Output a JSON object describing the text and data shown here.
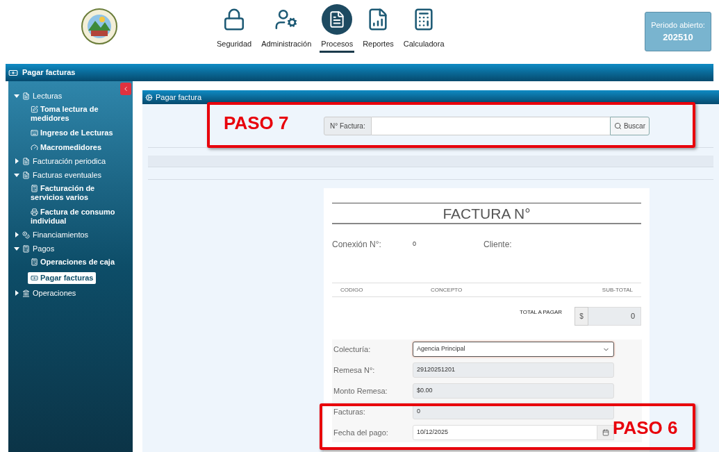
{
  "header": {
    "nav": [
      {
        "label": "Seguridad",
        "kind": "security",
        "selected": false
      },
      {
        "label": "Administración",
        "kind": "admin",
        "selected": false
      },
      {
        "label": "Procesos",
        "kind": "process",
        "selected": true
      },
      {
        "label": "Reportes",
        "kind": "report",
        "selected": false
      },
      {
        "label": "Calculadora",
        "kind": "calc",
        "selected": false
      }
    ],
    "period": {
      "label": "Periodo abierto:",
      "value": "202510"
    }
  },
  "window": {
    "title": "Pagar facturas"
  },
  "sidebar": {
    "items": [
      {
        "label": "Lecturas",
        "kind": "file",
        "expanded": true,
        "children": [
          {
            "label": "Toma lectura de medidores",
            "kind": "edit",
            "selected": false
          },
          {
            "label": "Ingreso de Lecturas",
            "kind": "keyboard",
            "selected": false
          },
          {
            "label": "Macromedidores",
            "kind": "gauge",
            "selected": false
          }
        ]
      },
      {
        "label": "Facturación periodica",
        "kind": "file",
        "expanded": false
      },
      {
        "label": "Facturas eventuales",
        "kind": "file",
        "expanded": true,
        "children": [
          {
            "label": "Facturación de servicios varios",
            "kind": "register",
            "selected": false
          },
          {
            "label": "Factura de consumo individual",
            "kind": "print",
            "selected": false
          }
        ]
      },
      {
        "label": "Financiamientos",
        "kind": "coins",
        "expanded": false
      },
      {
        "label": "Pagos",
        "kind": "register",
        "expanded": true,
        "children": [
          {
            "label": "Operaciones de caja",
            "kind": "register",
            "selected": false
          },
          {
            "label": "Pagar facturas",
            "kind": "money",
            "selected": true
          }
        ]
      },
      {
        "label": "Operaciones",
        "kind": "bank",
        "expanded": false
      }
    ]
  },
  "panel": {
    "title": "Pagar factura",
    "search": {
      "label": "N° Factura:",
      "button": "Buscar"
    }
  },
  "invoice": {
    "title": "FACTURA N°",
    "connection_label": "Conexión N°:",
    "connection_value": "0",
    "client_label": "Cliente:",
    "columns": [
      "CODIGO",
      "CONCEPTO",
      "SUB-TOTAL"
    ],
    "total": {
      "label": "TOTAL A PAGAR",
      "currency": "$",
      "value": "0"
    },
    "form": [
      {
        "label": "Colecturía:",
        "kind": "select",
        "value": "Agencia Principal"
      },
      {
        "label": "Remesa N°:",
        "kind": "readonly",
        "value": "29120251201"
      },
      {
        "label": "Monto Remesa:",
        "kind": "readonly",
        "value": "$0.00"
      },
      {
        "label": "Facturas:",
        "kind": "readonly",
        "value": "0"
      },
      {
        "label": "Fecha del pago:",
        "kind": "date",
        "value": "10/12/2025"
      }
    ]
  },
  "annotations": [
    {
      "label": "PASO 7"
    },
    {
      "label": "PASO 6"
    }
  ]
}
